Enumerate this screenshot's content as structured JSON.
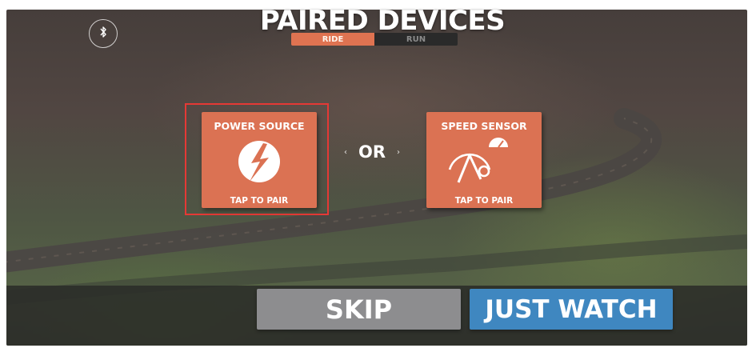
{
  "header": {
    "title": "PAIRED DEVICES",
    "sport_tabs": [
      {
        "label": "RIDE",
        "selected": true
      },
      {
        "label": "RUN",
        "selected": false
      }
    ]
  },
  "devices": {
    "power_source": {
      "title": "POWER SOURCE",
      "cta": "TAP TO PAIR",
      "icon": "power-bolt-icon",
      "highlighted": true
    },
    "separator": "OR",
    "speed_sensor": {
      "title": "SPEED SENSOR",
      "cta": "TAP TO PAIR",
      "icon": "speed-sensor-icon"
    }
  },
  "actions": {
    "skip_label": "SKIP",
    "watch_label": "JUST WATCH"
  },
  "icons": {
    "bluetooth": "bluetooth-icon"
  },
  "colors": {
    "tile": "#db7253",
    "ride_tab": "#df7351",
    "run_tab": "#2a2a2a",
    "skip_button": "#8d8d8f",
    "watch_button": "#3f87c0",
    "selection_outline": "#e53935"
  }
}
